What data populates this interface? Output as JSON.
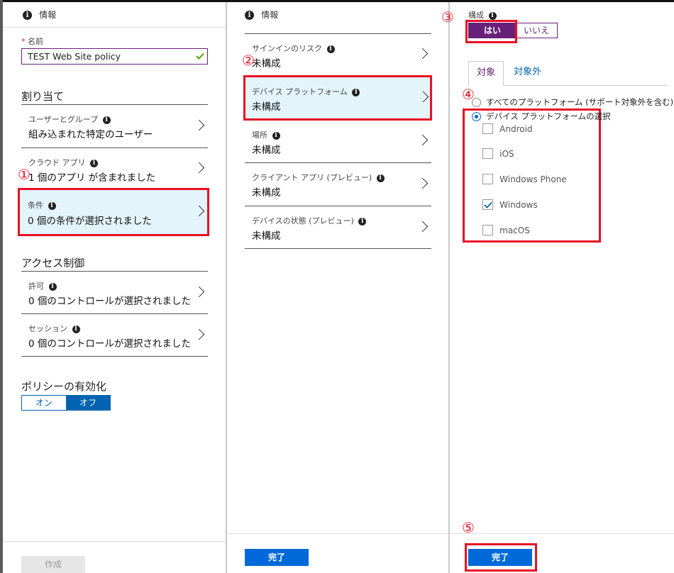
{
  "panel1": {
    "header": "情報",
    "name_label": "名前",
    "name_value": "TEST Web Site policy",
    "assign_title": "割り当て",
    "items": [
      {
        "label": "ユーザーとグループ",
        "value": "組み込まれた特定のユーザー"
      },
      {
        "label": "クラウド アプリ",
        "value": "1 個のアプリ が含まれました"
      },
      {
        "label": "条件",
        "value": "0 個の条件が選択されました"
      }
    ],
    "access_title": "アクセス制御",
    "access_items": [
      {
        "label": "許可",
        "value": "0 個のコントロールが選択されました"
      },
      {
        "label": "セッション",
        "value": "0 個のコントロールが選択されました"
      }
    ],
    "enable_title": "ポリシーの有効化",
    "toggle_on": "オン",
    "toggle_off": "オフ",
    "create_button": "作成"
  },
  "panel2": {
    "header": "情報",
    "items": [
      {
        "label": "サインインのリスク",
        "value": "未構成"
      },
      {
        "label": "デバイス プラットフォーム",
        "value": "未構成"
      },
      {
        "label": "場所",
        "value": "未構成"
      },
      {
        "label": "クライアント アプリ (プレビュー)",
        "value": "未構成"
      },
      {
        "label": "デバイスの状態 (プレビュー)",
        "value": "未構成"
      }
    ],
    "done_button": "完了"
  },
  "panel3": {
    "config_label": "構成",
    "yes": "はい",
    "no": "いいえ",
    "tab_include": "対象",
    "tab_exclude": "対象外",
    "radio_all": "すべてのプラットフォーム (サポート対象外を含む)",
    "radio_select": "デバイス プラットフォームの選択",
    "platforms": [
      {
        "label": "Android",
        "checked": false
      },
      {
        "label": "iOS",
        "checked": false
      },
      {
        "label": "Windows Phone",
        "checked": false
      },
      {
        "label": "Windows",
        "checked": true
      },
      {
        "label": "macOS",
        "checked": false
      }
    ],
    "done_button": "完了"
  },
  "callouts": {
    "c1": "①",
    "c2": "②",
    "c3": "③",
    "c4": "④",
    "c5": "⑤"
  },
  "colors": {
    "accent_purple": "#68217a",
    "highlight_bg": "#e3f4fb",
    "callout_red": "#e81123",
    "primary_blue": "#0069d9",
    "toggle_blue": "#0063b1",
    "check_green": "#57a300"
  }
}
